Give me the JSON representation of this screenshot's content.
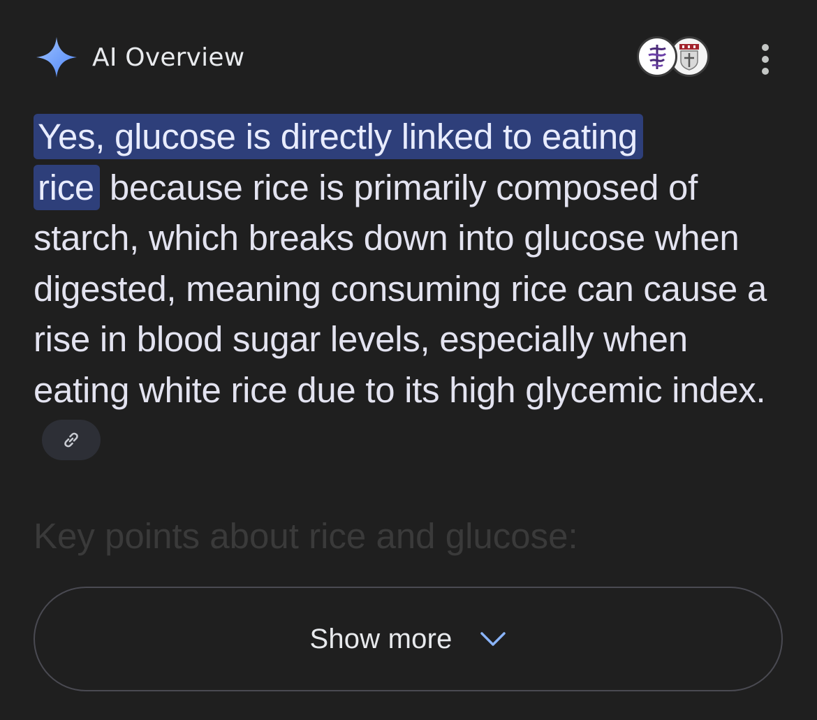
{
  "header": {
    "title": "AI Overview",
    "sparkle_icon": "sparkle-icon",
    "sparkle_color": "#7aa7ff"
  },
  "sources": {
    "icons": [
      "source-logo-1-icon",
      "source-logo-2-icon"
    ]
  },
  "menu": {
    "icon": "more-vert-icon"
  },
  "answer": {
    "highlight_part1": "Yes, glucose is directly linked to eating",
    "highlight_part2": "rice",
    "body": " because rice is primarily composed of starch, which breaks down into glucose when digested, meaning consuming rice can cause a rise in blood sugar levels, especially when eating white rice due to its high glycemic index.",
    "highlight_color": "#2e3f7a",
    "link_icon": "link-icon"
  },
  "faded_heading": "Key points about rice and glucose:",
  "show_more": {
    "label": "Show more",
    "icon": "chevron-down-icon",
    "icon_color": "#8ab4f8"
  }
}
